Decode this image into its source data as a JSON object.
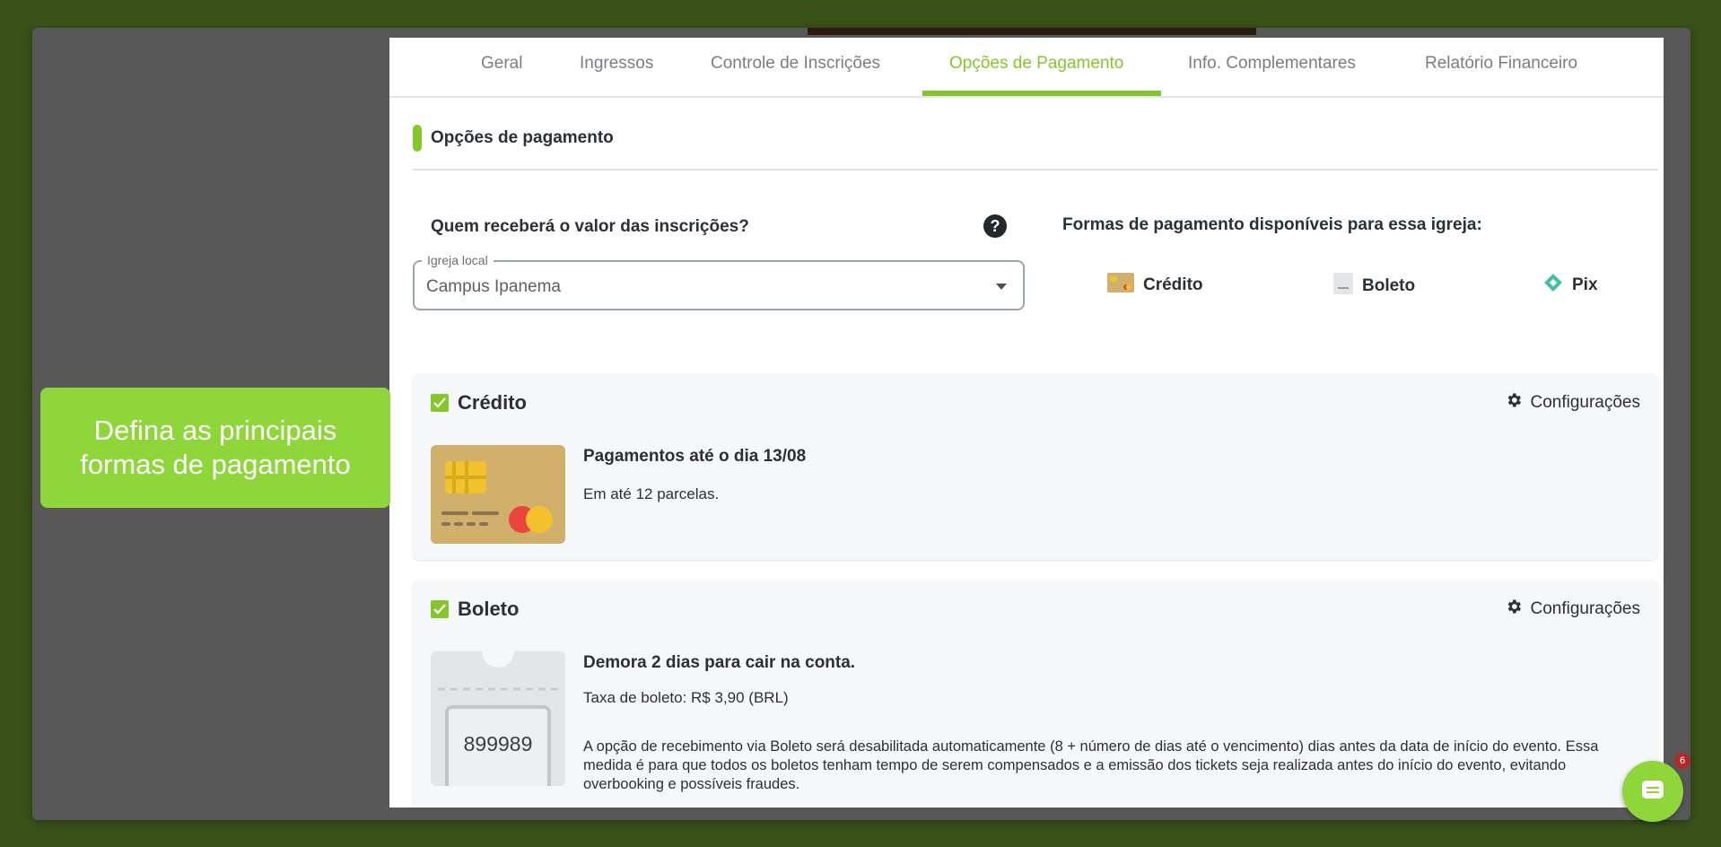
{
  "tabs": [
    {
      "label": "Geral"
    },
    {
      "label": "Ingressos"
    },
    {
      "label": "Controle de Inscrições"
    },
    {
      "label": "Opções de Pagamento",
      "active": true
    },
    {
      "label": "Info. Complementares"
    },
    {
      "label": "Relatório Financeiro"
    }
  ],
  "callout": {
    "text": "Defina as principais formas de pagamento"
  },
  "section": {
    "title": "Opções de pagamento"
  },
  "receiver": {
    "question": "Quem receberá o valor das inscrições?",
    "help_icon": "?",
    "select_label": "Igreja local",
    "select_value": "Campus Ipanema"
  },
  "available": {
    "title": "Formas de pagamento disponíveis para essa igreja:",
    "methods": [
      {
        "label": "Crédito",
        "icon": "credit-card-icon"
      },
      {
        "label": "Boleto",
        "icon": "boleto-icon"
      },
      {
        "label": "Pix",
        "icon": "pix-icon"
      }
    ]
  },
  "credit": {
    "title": "Crédito",
    "checked": true,
    "config_label": "Configurações",
    "line1": "Pagamentos até o dia 13/08",
    "line2": "Em até 12 parcelas."
  },
  "boleto": {
    "title": "Boleto",
    "checked": true,
    "config_label": "Configurações",
    "line1": "Demora 2 dias para cair na conta.",
    "line2": "Taxa de boleto: R$ 3,90 (BRL)",
    "description": "A opção de recebimento via Boleto será desabilitada automaticamente (8 + número de dias até o vencimento) dias antes da data de início do evento. Essa medida é para que todos os boletos tenham tempo de serem compensados e a emissão dos tickets seja realizada antes do início do evento, evitando overbooking e possíveis fraudes.",
    "image_number": "899989"
  },
  "chat": {
    "badge": "6"
  },
  "colors": {
    "accent": "#87c52d",
    "callout": "#8ed63a",
    "text": "#2b3036"
  }
}
